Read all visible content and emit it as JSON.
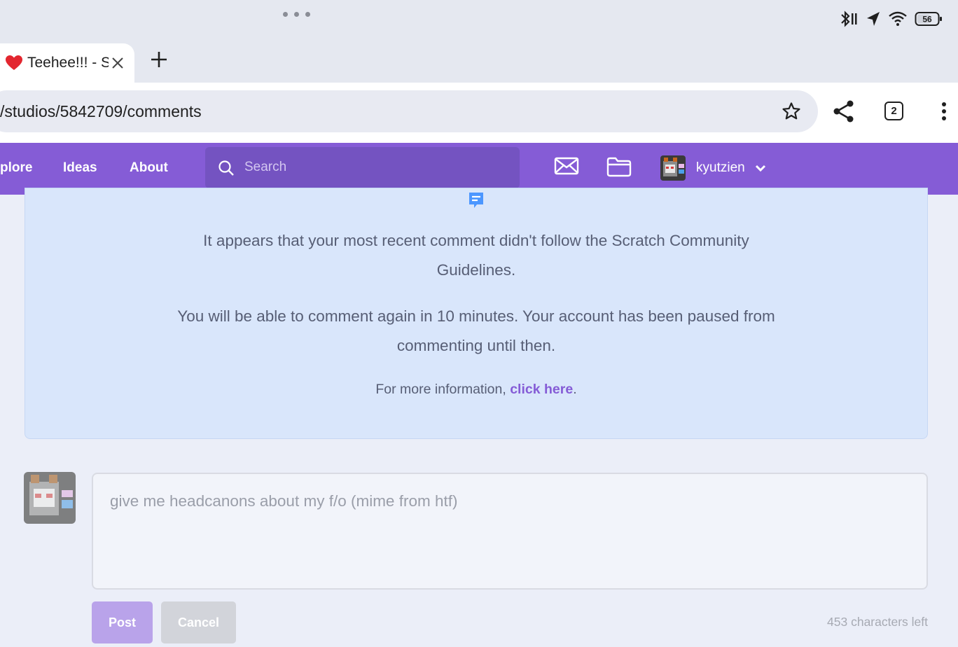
{
  "browser": {
    "tab_title": "Teehee!!! - S",
    "url": "/studios/5842709/comments",
    "tab_count": "2",
    "battery_level": "56"
  },
  "nav": {
    "links": [
      "plore",
      "Ideas",
      "About"
    ],
    "search_placeholder": "Search",
    "username": "kyutzien"
  },
  "notice": {
    "line1": "It appears that your most recent comment didn't follow the Scratch Community Guidelines.",
    "line2": "You will be able to comment again in 10 minutes. Your account has been paused from commenting until then.",
    "more_info_prefix": "For more information,",
    "more_info_link": "click here",
    "more_info_suffix": "."
  },
  "compose": {
    "draft_text": "give me headcanons about my f/o (mime from htf)",
    "post_label": "Post",
    "cancel_label": "Cancel",
    "chars_left": "453 characters left"
  },
  "colors": {
    "brand_purple": "#855cd6",
    "notice_bg": "#d9e6fb",
    "text": "#575e75"
  },
  "icons": [
    "bluetooth-icon",
    "location-icon",
    "wifi-icon",
    "battery-icon",
    "heart-favicon",
    "close-icon",
    "plus-icon",
    "star-icon",
    "share-icon",
    "tab-switcher-icon",
    "more-vert-icon",
    "search-icon",
    "mail-icon",
    "folder-icon",
    "chevron-down-icon",
    "comment-icon"
  ]
}
